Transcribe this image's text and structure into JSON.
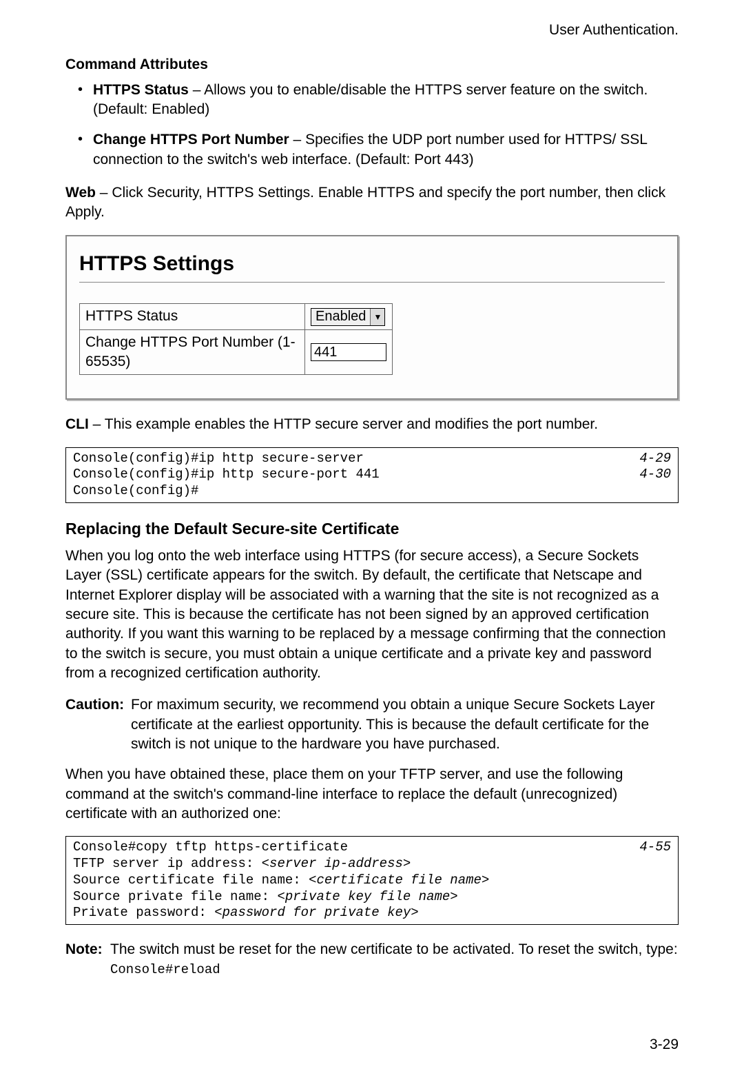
{
  "header": {
    "right": "User Authentication."
  },
  "section1": {
    "heading": "Command Attributes",
    "bullets": [
      {
        "term": "HTTPS Status",
        "sep": " – ",
        "desc": "Allows you to enable/disable the HTTPS server feature on the switch. (Default: Enabled)"
      },
      {
        "term": "Change HTTPS Port Number",
        "sep": " – ",
        "desc": "Specifies the UDP port number used for HTTPS/ SSL connection to the switch's web interface. (Default: Port 443)"
      }
    ]
  },
  "web_para": {
    "label": "Web",
    "sep": " – ",
    "text": "Click Security, HTTPS Settings. Enable HTTPS and specify the port number, then click Apply."
  },
  "screenshot": {
    "title": "HTTPS Settings",
    "rows": [
      {
        "label": "HTTPS Status",
        "value": "Enabled",
        "type": "select"
      },
      {
        "label": "Change HTTPS Port Number (1-65535)",
        "value": "441",
        "type": "text"
      }
    ]
  },
  "cli_para": {
    "label": "CLI",
    "sep": " – ",
    "text": "This example enables the HTTP secure server and modifies the port number."
  },
  "cli1": {
    "lines": [
      {
        "cmd": "Console(config)#ip http secure-server",
        "ref": "4-29"
      },
      {
        "cmd": "Console(config)#ip http secure-port 441",
        "ref": "4-30"
      },
      {
        "cmd": "Console(config)#",
        "ref": ""
      }
    ]
  },
  "subheading": "Replacing the Default Secure-site Certificate",
  "para2": "When you log onto the web interface using HTTPS (for secure access), a Secure Sockets Layer (SSL) certificate appears for the switch. By default, the certificate that Netscape and Internet Explorer display will be associated with a warning that the site is not recognized as a secure site. This is because the certificate has not been signed by an approved certification authority. If you want this warning to be replaced by a message confirming that the connection to the switch is secure, you must obtain a unique certificate and a private key and password from a recognized certification authority.",
  "caution": {
    "label": "Caution:",
    "text": "For maximum security, we recommend you obtain a unique Secure Sockets Layer certificate at the earliest opportunity. This is because the default certificate for the switch is not unique to the hardware you have purchased."
  },
  "para3": "When you have obtained these, place them on your TFTP server, and use the following command at the switch's command-line interface to replace the default (unrecognized) certificate with an authorized one:",
  "cli2": {
    "line1_cmd": "Console#copy tftp https-certificate",
    "line1_ref": "4-55",
    "line2_a": "TFTP server ip address: ",
    "line2_b": "<server ip-address>",
    "line3_a": "Source certificate file name: ",
    "line3_b": "<certificate file name>",
    "line4_a": "Source private file name: ",
    "line4_b": "<private key file name>",
    "line5_a": "Private password: ",
    "line5_b": "<password for private key>"
  },
  "note": {
    "label": "Note:",
    "text_a": "The switch must be reset for the new certificate to be activated. To reset the switch, type: ",
    "code": "Console#reload"
  },
  "page_num": "3-29"
}
